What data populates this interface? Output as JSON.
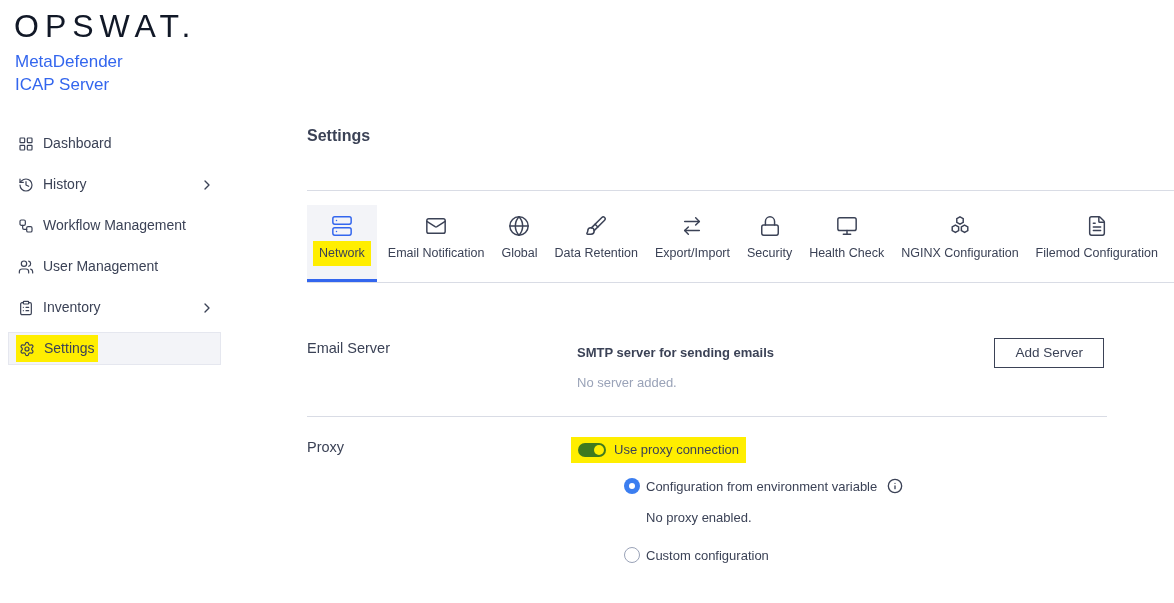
{
  "brand": {
    "logo": "OPSWAT.",
    "product_line_1": "MetaDefender",
    "product_line_2": "ICAP Server"
  },
  "sidebar": {
    "items": [
      {
        "label": "Dashboard",
        "has_submenu": false,
        "selected": false,
        "highlighted": false
      },
      {
        "label": "History",
        "has_submenu": true,
        "selected": false,
        "highlighted": false
      },
      {
        "label": "Workflow Management",
        "has_submenu": false,
        "selected": false,
        "highlighted": false
      },
      {
        "label": "User Management",
        "has_submenu": false,
        "selected": false,
        "highlighted": false
      },
      {
        "label": "Inventory",
        "has_submenu": true,
        "selected": false,
        "highlighted": false
      },
      {
        "label": "Settings",
        "has_submenu": false,
        "selected": true,
        "highlighted": true
      }
    ]
  },
  "page_title": "Settings",
  "tabs": [
    {
      "label": "Network",
      "selected": true,
      "highlighted": true
    },
    {
      "label": "Email Notification",
      "selected": false,
      "highlighted": false
    },
    {
      "label": "Global",
      "selected": false,
      "highlighted": false
    },
    {
      "label": "Data Retention",
      "selected": false,
      "highlighted": false
    },
    {
      "label": "Export/Import",
      "selected": false,
      "highlighted": false
    },
    {
      "label": "Security",
      "selected": false,
      "highlighted": false
    },
    {
      "label": "Health Check",
      "selected": false,
      "highlighted": false
    },
    {
      "label": "NGINX Configuration",
      "selected": false,
      "highlighted": false
    },
    {
      "label": "Filemod Configuration",
      "selected": false,
      "highlighted": false
    }
  ],
  "email_server": {
    "heading": "Email Server",
    "title": "SMTP server for sending emails",
    "status": "No server added.",
    "button": "Add Server"
  },
  "proxy": {
    "heading": "Proxy",
    "toggle": {
      "label": "Use proxy connection",
      "on": true,
      "highlighted": true
    },
    "options": [
      {
        "label": "Configuration from environment variable",
        "selected": true,
        "info": true,
        "note": "No proxy enabled."
      },
      {
        "label": "Custom configuration",
        "selected": false,
        "info": false
      }
    ]
  }
}
